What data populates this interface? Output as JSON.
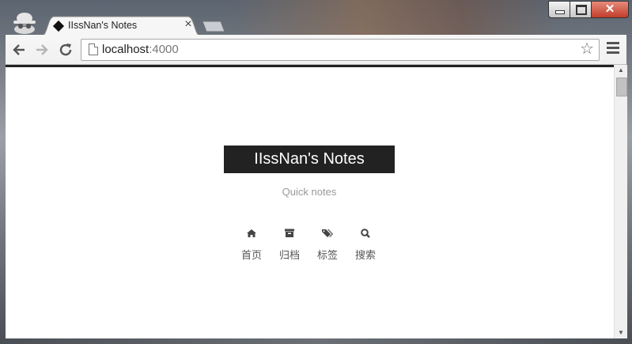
{
  "browser": {
    "tab": {
      "title": "IIssNan's Notes"
    },
    "address_bar": {
      "host": "localhost",
      "port": ":4000"
    },
    "window_controls": {
      "close_symbol": "✕"
    }
  },
  "site": {
    "title": "IIssNan's Notes",
    "subtitle": "Quick notes",
    "menu": [
      {
        "icon": "home-icon",
        "label": "首页"
      },
      {
        "icon": "archive-icon",
        "label": "归档"
      },
      {
        "icon": "tags-icon",
        "label": "标签"
      },
      {
        "icon": "search-icon",
        "label": "搜索"
      }
    ]
  },
  "colors": {
    "title_bg": "#222222",
    "title_text": "#ffffff",
    "subtitle": "#999999",
    "menu_text": "#555555"
  }
}
